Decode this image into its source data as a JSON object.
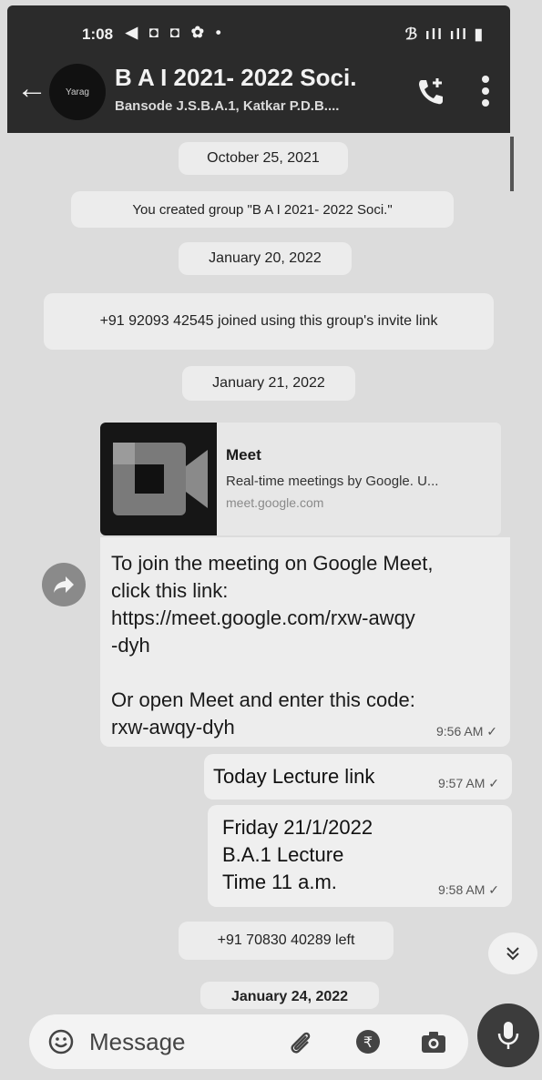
{
  "status_bar": {
    "time": "1:08",
    "icons_left": "◀ ◘ ◘ ✿ •",
    "icons_right": "ℬ ıll ıll ▮"
  },
  "header": {
    "title": "B A I 2021- 2022 Soci.",
    "subtitle": "Bansode J.S.B.A.1, Katkar P.D.B....",
    "avatar_text": "Yarag"
  },
  "chat": {
    "date1": "October 25, 2021",
    "created_notice": "You created group \"B A I 2021- 2022 Soci.\"",
    "date2": "January 20, 2022",
    "join_notice": "+91 92093 42545 joined using this group's invite link",
    "date3": "January 21, 2022",
    "link_preview": {
      "title": "Meet",
      "description": "Real-time meetings by Google. U...",
      "url": "meet.google.com"
    },
    "message1": {
      "text": "To join the meeting on Google Meet,\nclick this link:\nhttps://meet.google.com/rxw-awqy\n-dyh\n\nOr open Meet and enter this code:\nrxw-awqy-dyh",
      "time": "9:56 AM ✓"
    },
    "message2": {
      "text": "Today Lecture link",
      "time": "9:57 AM ✓"
    },
    "message3": {
      "text": "Friday 21/1/2022\nB.A.1 Lecture\nTime 11 a.m.",
      "time": "9:58 AM ✓"
    },
    "left_notice": "+91 70830 40289 left",
    "date4": "January 24, 2022"
  },
  "input_bar": {
    "placeholder": "Message"
  },
  "colors": {
    "header_bg": "#2b2b2b",
    "chat_bg": "#dcdcdc",
    "bubble_bg": "#efefef"
  }
}
